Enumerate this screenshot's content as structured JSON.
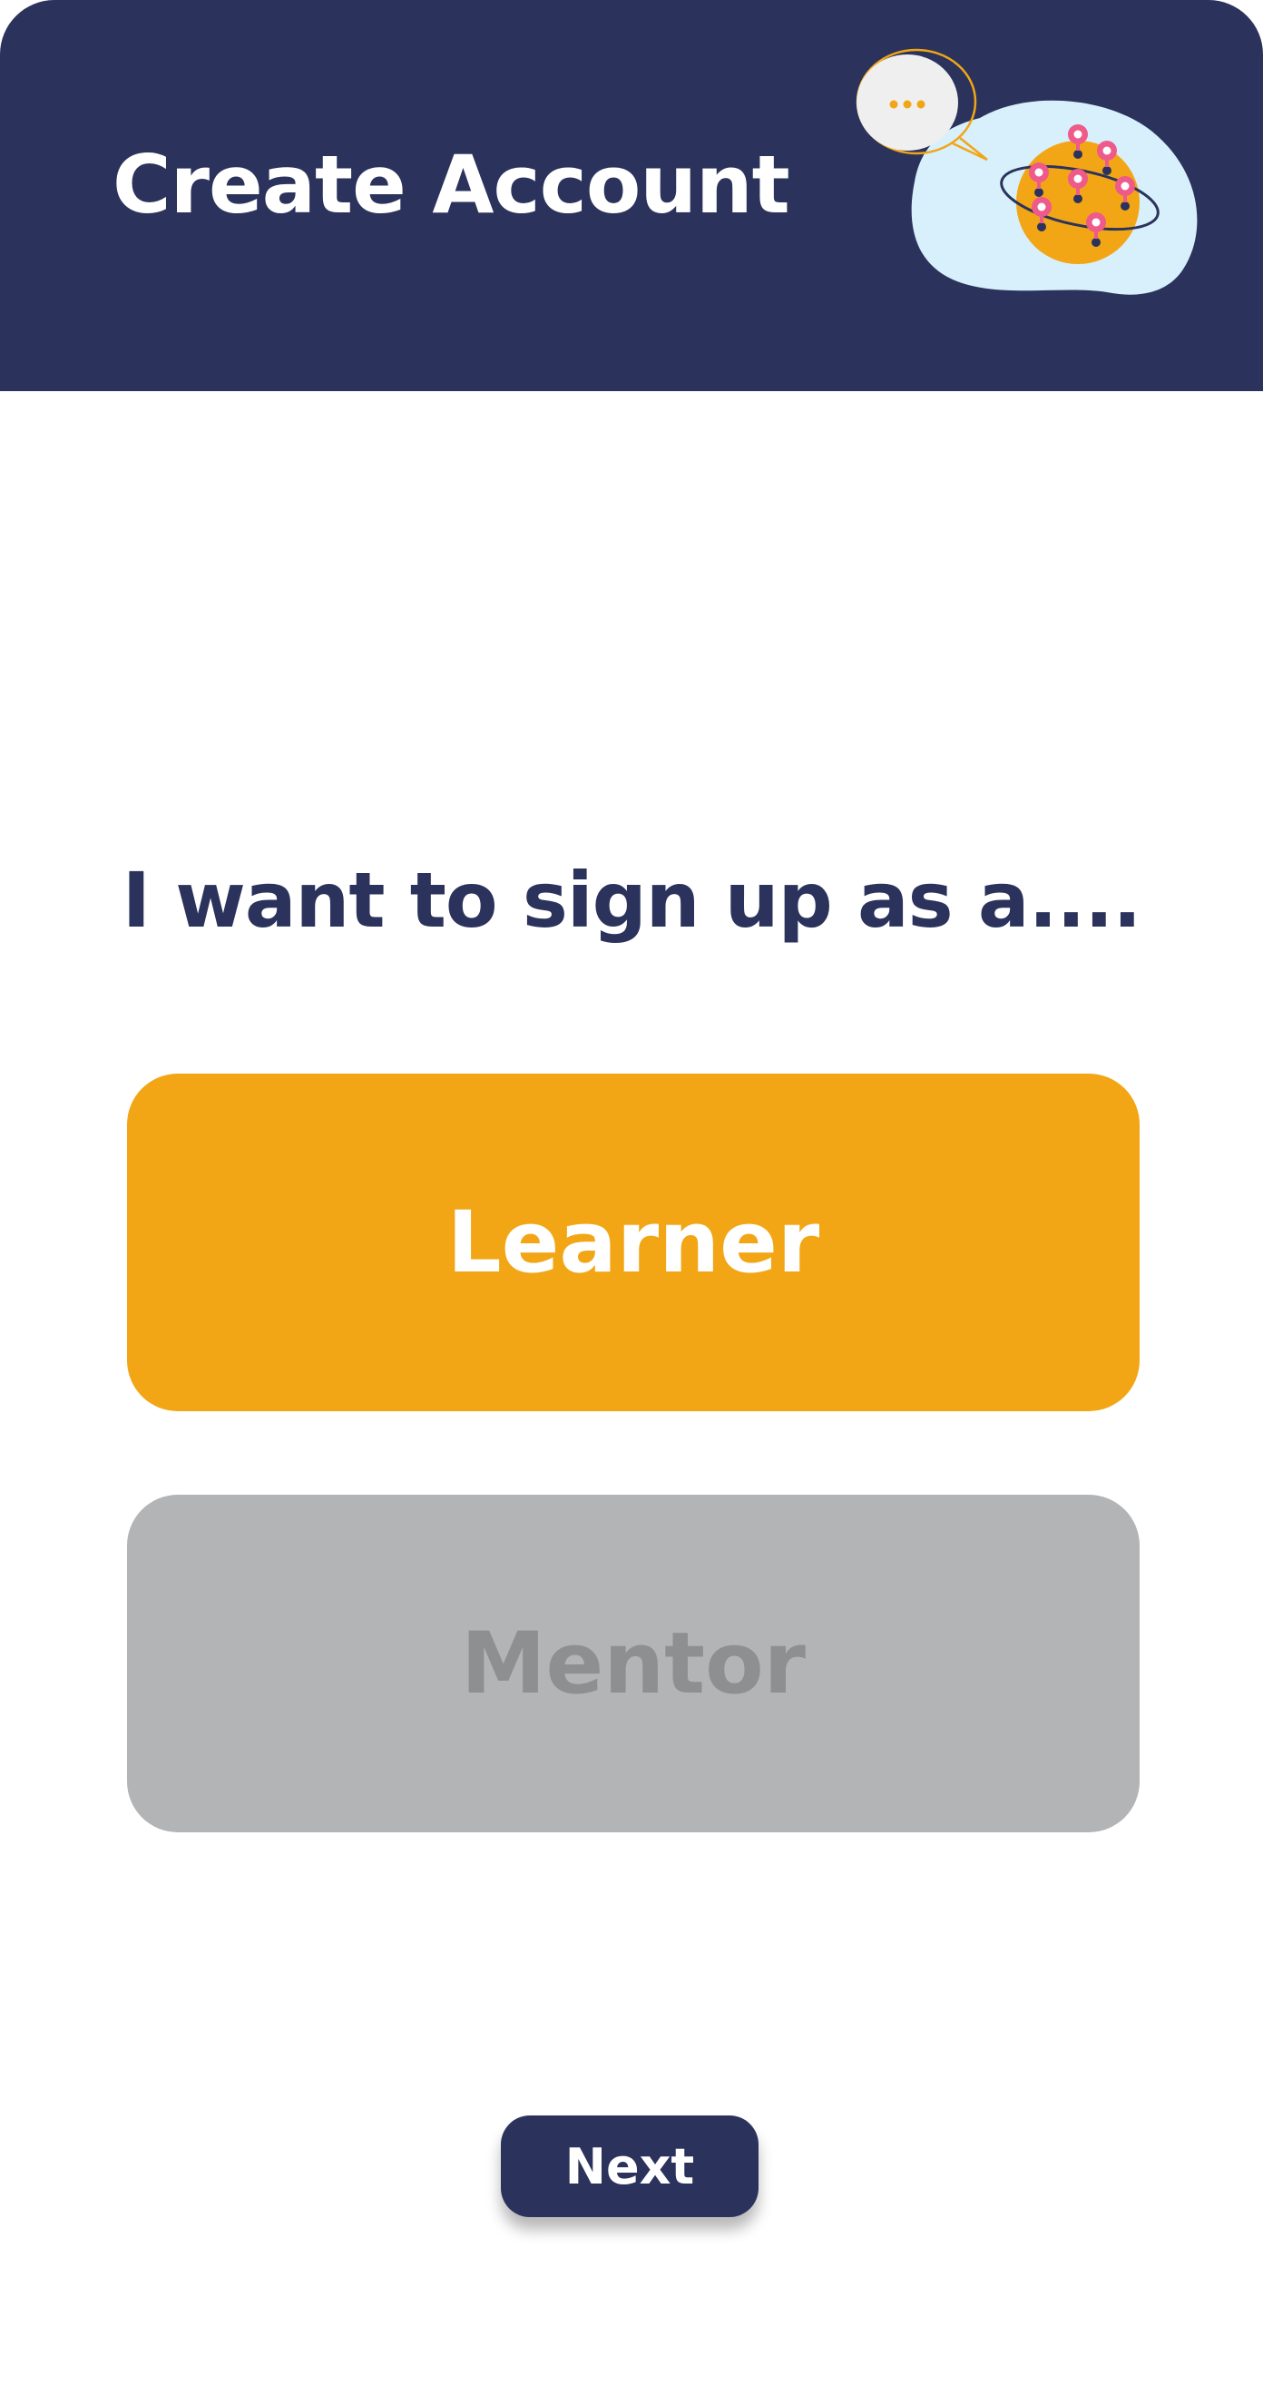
{
  "header": {
    "title": "Create Account",
    "illustration_icon": "globe-chat-illustration-icon",
    "chat_bubble_text": "..."
  },
  "main": {
    "prompt": "I want to sign up as a....",
    "options": [
      {
        "label": "Learner",
        "selected": true,
        "color": "#f2a615"
      },
      {
        "label": "Mentor",
        "selected": false,
        "color": "#b3b4b6"
      }
    ],
    "next_label": "Next"
  },
  "colors": {
    "brand_navy": "#2b335c",
    "accent_orange": "#f2a615",
    "inactive_gray": "#b3b4b6",
    "background": "#ffffff"
  }
}
